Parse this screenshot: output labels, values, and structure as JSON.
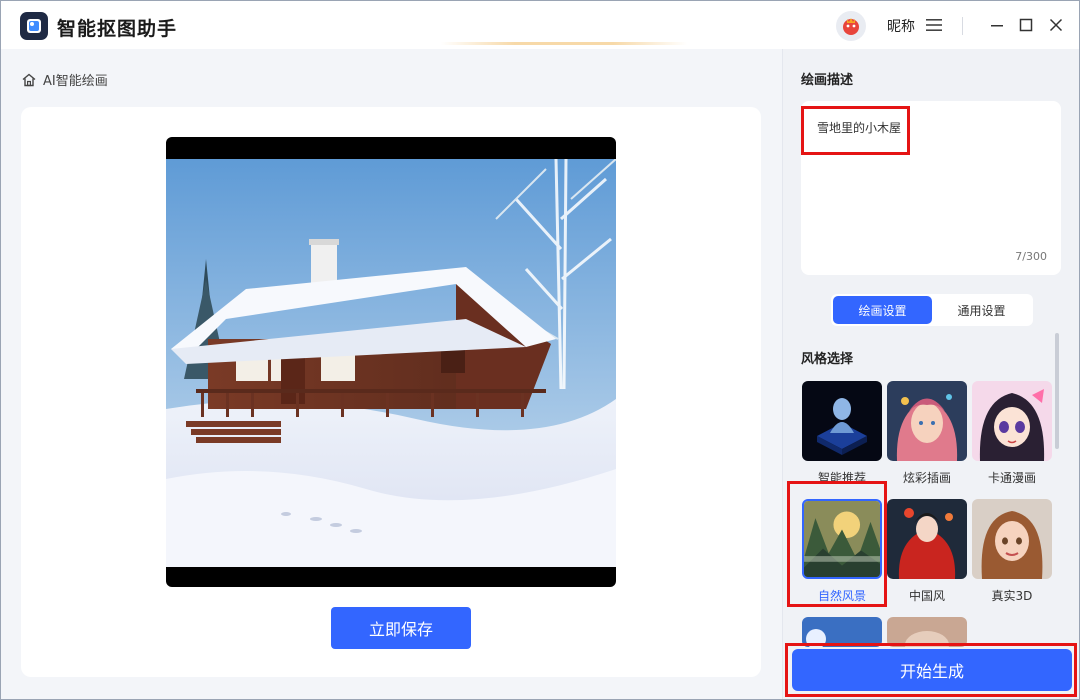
{
  "app": {
    "title": "智能抠图助手"
  },
  "header": {
    "nickname": "昵称"
  },
  "breadcrumb": {
    "label": "AI智能绘画"
  },
  "preview": {
    "save_label": "立即保存"
  },
  "panel": {
    "desc_title": "绘画描述",
    "desc_text": "雪地里的小木屋",
    "desc_count": "7/300",
    "tabs": [
      {
        "label": "绘画设置",
        "active": true
      },
      {
        "label": "通用设置",
        "active": false
      }
    ],
    "style_title": "风格选择",
    "styles": [
      {
        "label": "智能推荐"
      },
      {
        "label": "炫彩插画"
      },
      {
        "label": "卡通漫画"
      },
      {
        "label": "自然风景"
      },
      {
        "label": "中国风"
      },
      {
        "label": "真实3D"
      }
    ],
    "generate_label": "开始生成"
  },
  "colors": {
    "accent": "#3366ff",
    "highlight": "#e51414"
  }
}
